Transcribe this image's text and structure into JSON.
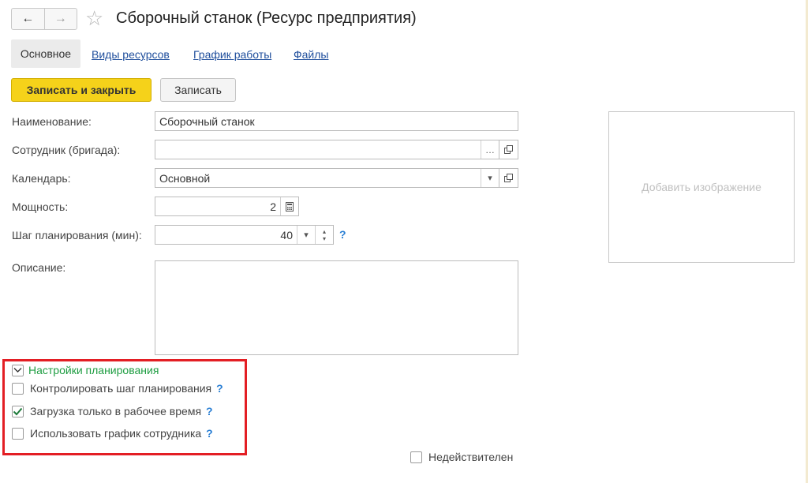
{
  "window": {
    "title": "Сборочный станок (Ресурс предприятия)"
  },
  "tabs": [
    {
      "label": "Основное"
    },
    {
      "label": "Виды ресурсов"
    },
    {
      "label": "График работы"
    },
    {
      "label": "Файлы"
    }
  ],
  "toolbar": {
    "save_close_label": "Записать и закрыть",
    "save_label": "Записать"
  },
  "form": {
    "name": {
      "label": "Наименование:",
      "value": "Сборочный станок"
    },
    "employee": {
      "label": "Сотрудник (бригада):",
      "value": ""
    },
    "calendar": {
      "label": "Календарь:",
      "value": "Основной"
    },
    "capacity": {
      "label": "Мощность:",
      "value": "2"
    },
    "step": {
      "label": "Шаг планирования (мин):",
      "value": "40"
    },
    "description": {
      "label": "Описание:",
      "value": ""
    }
  },
  "image": {
    "placeholder": "Добавить изображение"
  },
  "planning": {
    "title": "Настройки планирования",
    "items": [
      {
        "label": "Контролировать шаг планирования",
        "checked": false
      },
      {
        "label": "Загрузка только в рабочее время",
        "checked": true
      },
      {
        "label": "Использовать график сотрудника",
        "checked": false
      }
    ]
  },
  "inactive": {
    "label": "Недействителен",
    "checked": false
  },
  "help_glyph": "?",
  "colors": {
    "primary_button": "#f5d21a",
    "link": "#1f4e9c",
    "group_title": "#1e9d42",
    "highlight_box": "#e31e24"
  }
}
